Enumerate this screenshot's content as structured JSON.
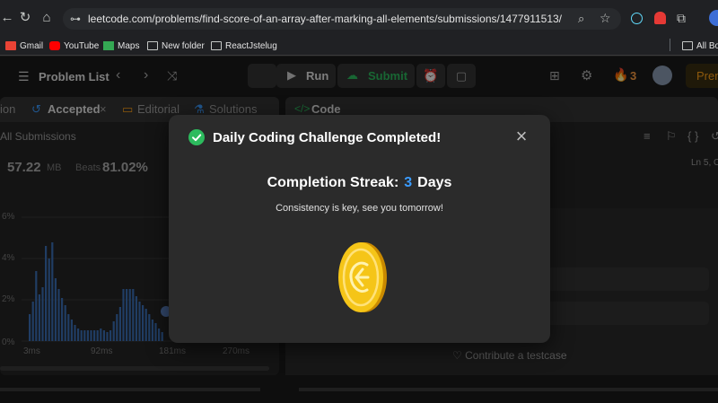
{
  "browser": {
    "url": "leetcode.com/problems/find-score-of-an-array-after-marking-all-elements/submissions/1477911513/",
    "bookmarks": [
      "Gmail",
      "YouTube",
      "Maps",
      "New folder",
      "ReactJstelug",
      "All Boo"
    ]
  },
  "header": {
    "problem_list": "Problem List",
    "run": "Run",
    "submit": "Submit",
    "streak_count": "3",
    "premium": "Prem"
  },
  "left_panel": {
    "tabs": [
      "ion",
      "Accepted",
      "Editorial",
      "Solutions"
    ],
    "all_submissions": "All Submissions",
    "memory": "57.22",
    "memory_unit": "MB",
    "beats_label": "Beats",
    "beats_value": "81.02%",
    "y_ticks": [
      "6%",
      "4%",
      "2%",
      "0%"
    ],
    "x_ticks": [
      "3ms",
      "92ms",
      "181ms",
      "270ms"
    ]
  },
  "right_panel": {
    "code_tab": "Code",
    "ln_status": "Ln 5, C",
    "contribute": "Contribute a testcase"
  },
  "modal": {
    "title": "Daily Coding Challenge Completed!",
    "streak_label": "Completion Streak:",
    "streak_value": "3",
    "streak_unit": "Days",
    "subtitle": "Consistency is key, see you tomorrow!"
  },
  "colors": {
    "accent_green": "#2cbb5d",
    "accent_blue": "#3b9cff",
    "coin_gold": "#f5c518"
  }
}
